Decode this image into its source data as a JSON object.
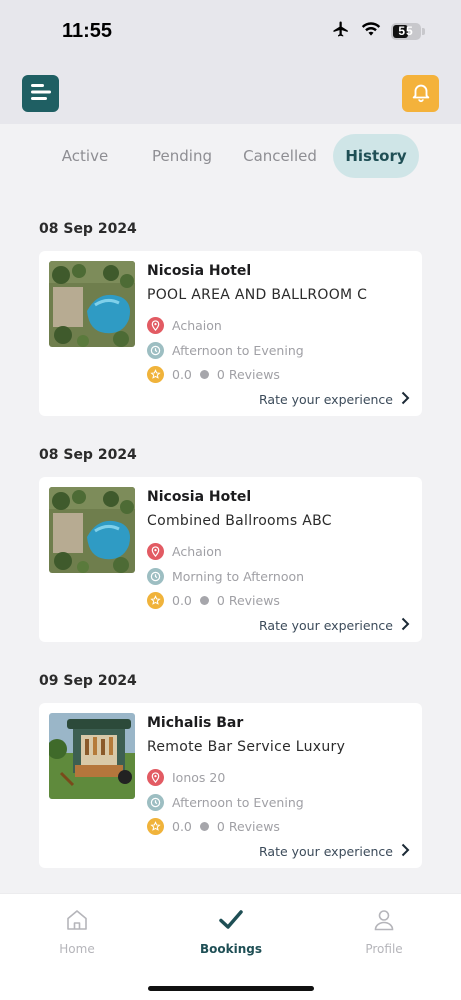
{
  "status_bar": {
    "time": "11:55",
    "battery": "55",
    "icons": [
      "airplane-icon",
      "wifi-icon",
      "battery-icon"
    ]
  },
  "header": {
    "menu_icon": "menu-icon",
    "bell_icon": "bell-icon",
    "colors": {
      "menu_bg": "#1f5f63",
      "bell_bg": "#f4b23b"
    }
  },
  "tabs": [
    {
      "label": "Active",
      "selected": false
    },
    {
      "label": "Pending",
      "selected": false
    },
    {
      "label": "Cancelled",
      "selected": false
    },
    {
      "label": "History",
      "selected": true
    }
  ],
  "bookings": [
    {
      "date": "08 Sep 2024",
      "venue": "Nicosia Hotel",
      "space": "POOL AREA AND BALLROOM C",
      "location": "Achaion",
      "time_slot": "Afternoon to Evening",
      "rating": "0.0",
      "reviews": "0 Reviews",
      "cta": "Rate your experience",
      "image": "hotel-pool-photo"
    },
    {
      "date": "08 Sep 2024",
      "venue": "Nicosia Hotel",
      "space": "Combined Ballrooms ABC",
      "location": "Achaion",
      "time_slot": "Morning to Afternoon",
      "rating": "0.0",
      "reviews": "0 Reviews",
      "cta": "Rate your experience",
      "image": "hotel-pool-photo"
    },
    {
      "date": "09 Sep 2024",
      "venue": "Michalis Bar",
      "space": "Remote Bar Service Luxury",
      "location": "Ionos 20",
      "time_slot": "Afternoon to Evening",
      "rating": "0.0",
      "reviews": "0 Reviews",
      "cta": "Rate your experience",
      "image": "mobile-bar-photo"
    }
  ],
  "tab_bar": [
    {
      "label": "Home",
      "icon": "home-icon",
      "selected": false
    },
    {
      "label": "Bookings",
      "icon": "checkmark-icon",
      "selected": true
    },
    {
      "label": "Profile",
      "icon": "profile-icon",
      "selected": false
    }
  ],
  "colors": {
    "accent": "#1f5f63",
    "tab_selected_bg": "#cfe5e7",
    "location_icon": "#e25b63",
    "clock_icon": "#9dbec2",
    "star_icon": "#f0b33b"
  }
}
